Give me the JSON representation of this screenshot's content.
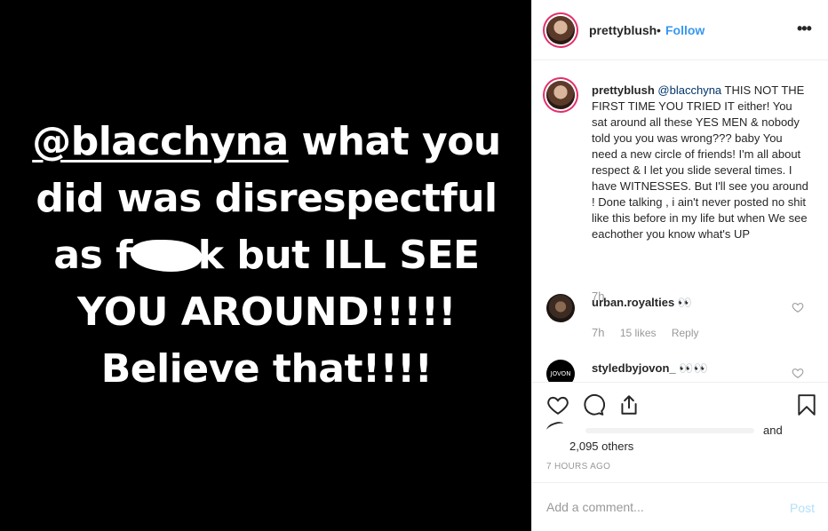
{
  "post": {
    "media_lines": {
      "mention": "@blacchyna",
      "line1_rest": " what you",
      "line2": "did was disrespectful",
      "line3_start": "as f",
      "line3_end": "k but ILL SEE",
      "line4": "YOU AROUND!!!!!",
      "line5": "Believe that!!!!"
    }
  },
  "header": {
    "username": "prettyblush",
    "separator": "•",
    "follow_label": "Follow",
    "more_icon": "more-options-icon"
  },
  "caption": {
    "username": "prettyblush",
    "mention": "@blacchyna",
    "text": " THIS NOT THE FIRST TIME YOU TRIED IT either! You sat around all these YES MEN & nobody told you you was wrong??? baby You need a new circle of friends! I'm all about respect & I let you slide several times. I have WITNESSES. But I'll see you around ! Done talking , i ain't never posted no shit like this before in my life but when We see eachother you know what's UP",
    "time": "7h"
  },
  "comments": [
    {
      "username": "urban.royalties",
      "text": "👀",
      "time": "7h",
      "likes": "15 likes",
      "reply_label": "Reply"
    },
    {
      "username": "styledbyjovon_",
      "text": "👀👀",
      "avatar_text": "JOVON"
    }
  ],
  "likes": {
    "and_label": "and",
    "others_label": "2,095 others"
  },
  "time_ago": "7 HOURS AGO",
  "add_comment": {
    "placeholder": "Add a comment...",
    "post_label": "Post"
  },
  "colors": {
    "accent": "#3897f0",
    "post_disabled": "#b2dffc",
    "muted": "#999999",
    "media_bg": "#000000"
  }
}
